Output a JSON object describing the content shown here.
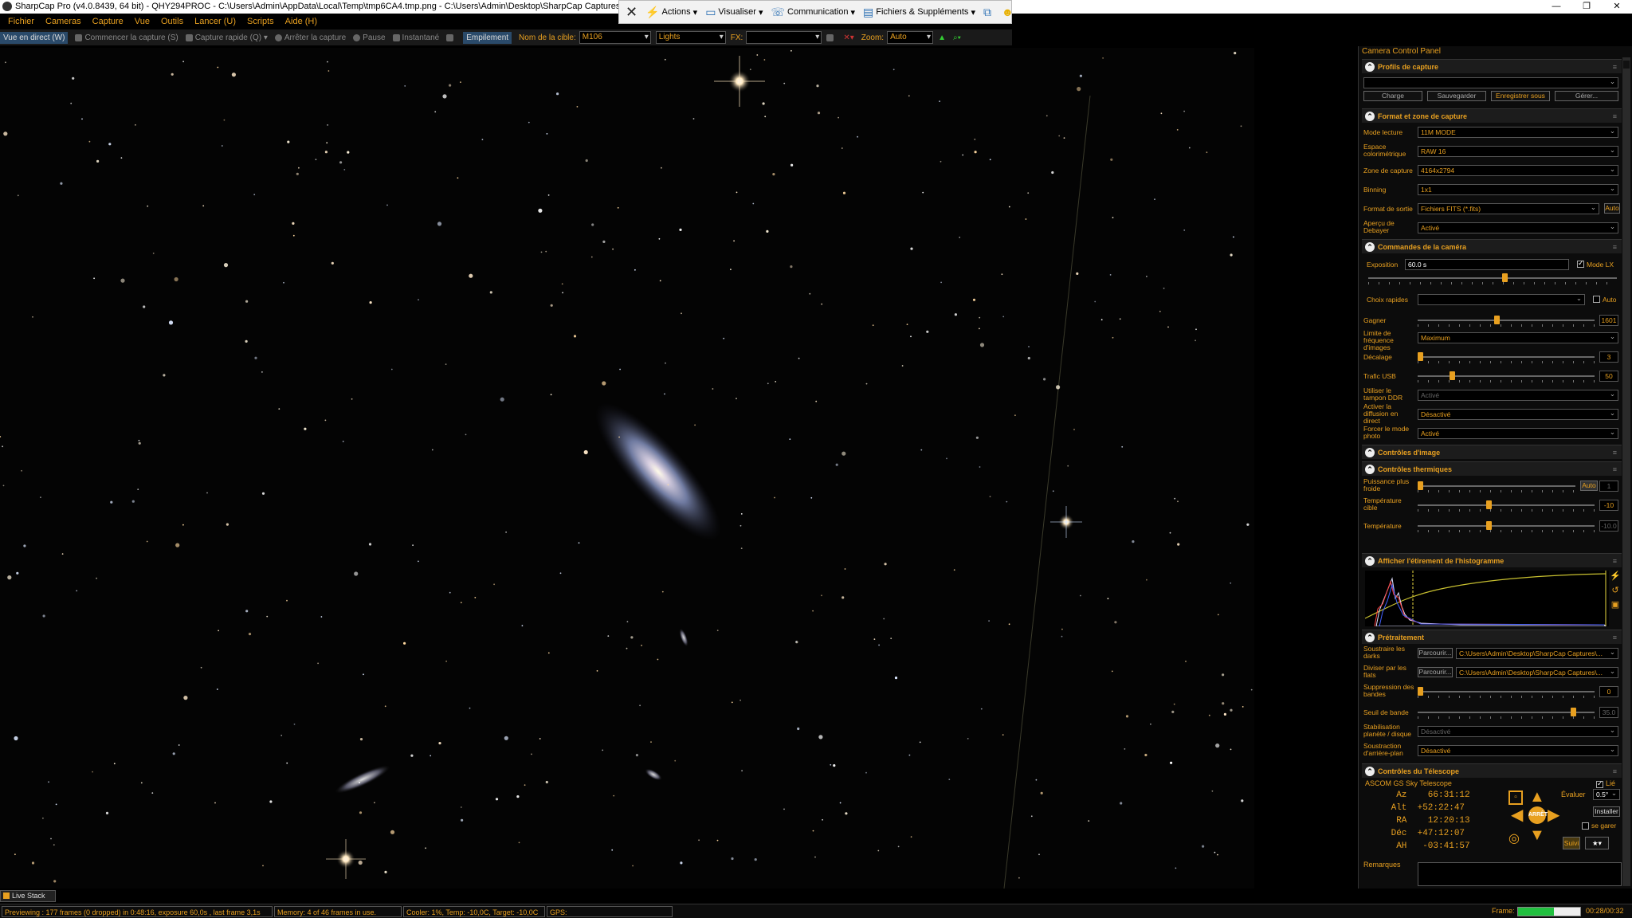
{
  "window": {
    "title": "SharpCap Pro (v4.0.8439, 64 bit) - QHY294PROC - C:\\Users\\Admin\\AppData\\Local\\Temp\\tmp6CA4.tmp.png - C:\\Users\\Admin\\Desktop\\SharpCap Captures",
    "minimize": "—",
    "maximize": "❐",
    "close": "✕"
  },
  "toolstrip": {
    "close": "✕",
    "items": [
      "Actions",
      "Visualiser",
      "Communication",
      "Fichiers & Suppléments"
    ]
  },
  "menu": [
    "Fichier",
    "Cameras",
    "Capture",
    "Vue",
    "Outils",
    "Lancer (U)",
    "Scripts",
    "Aide (H)"
  ],
  "capture_toolbar": {
    "live_view": "Vue en direct (W)",
    "start_capture": "Commencer la capture (S)",
    "quick_capture": "Capture rapide (Q)",
    "stop_capture": "Arrêter la capture",
    "pause": "Pause",
    "snapshot": "Instantané",
    "stacking": "Empilement",
    "target_label": "Nom de la cible:",
    "target_value": "M106",
    "frame_type": "Lights",
    "fx_label": "FX:",
    "fx_value": "",
    "zoom_label": "Zoom:",
    "zoom_value": "Auto"
  },
  "panel": {
    "title": "Camera Control Panel",
    "profiles": {
      "header": "Profils de capture",
      "selected": "",
      "buttons": [
        "Charge",
        "Sauvegarder",
        "Enregistrer sous",
        "Gérer..."
      ]
    },
    "format": {
      "header": "Format et zone de capture",
      "rows": [
        {
          "label": "Mode lecture",
          "value": "11M MODE"
        },
        {
          "label": "Espace colorimétrique",
          "value": "RAW 16"
        },
        {
          "label": "Zone de capture",
          "value": "4164x2794"
        },
        {
          "label": "Binning",
          "value": "1x1"
        },
        {
          "label": "Format de sortie",
          "value": "Fichiers FITS (*.fits)"
        },
        {
          "label": "Aperçu de Debayer",
          "value": "Activé"
        }
      ],
      "auto_label": "Auto"
    },
    "camera": {
      "header": "Commandes de la caméra",
      "exposure_label": "Exposition",
      "exposure_value": "60.0 s",
      "lx_mode": "Mode LX",
      "quick_pick_label": "Choix rapides",
      "quick_pick_value": "",
      "quick_pick_auto": "Auto",
      "gain_label": "Gagner",
      "gain_value": "1601",
      "framerate_label": "Limite de fréquence d'images",
      "framerate_value": "Maximum",
      "offset_label": "Décalage",
      "offset_value": "3",
      "usb_label": "Trafic USB",
      "usb_value": "50",
      "ddr_label": "Utiliser le tampon DDR",
      "ddr_value": "Activé",
      "broadcast_label": "Activer la diffusion en direct",
      "broadcast_value": "Désactivé",
      "photo_label": "Forcer le mode photo",
      "photo_value": "Activé"
    },
    "image_controls": {
      "header": "Contrôles d'image"
    },
    "thermal": {
      "header": "Contrôles thermiques",
      "cooler_label": "Puissance plus froide",
      "cooler_auto": "Auto",
      "cooler_value": "1",
      "target_label": "Température cible",
      "target_value": "-10",
      "temp_label": "Température",
      "temp_value": "-10.0"
    },
    "histogram": {
      "header": "Afficher l'étirement de l'histogramme"
    },
    "preprocessing": {
      "header": "Prétraitement",
      "dark_label": "Soustraire les darks",
      "dark_button": "Parcourir...",
      "dark_value": "C:\\Users\\Admin\\Desktop\\SharpCap Captures\\...",
      "flat_label": "Diviser par les flats",
      "flat_button": "Parcourir...",
      "flat_value": "C:\\Users\\Admin\\Desktop\\SharpCap Captures\\...",
      "banding_label": "Suppression des bandes",
      "banding_value": "0",
      "threshold_label": "Seuil de bande",
      "threshold_value": "35.0",
      "stab_label": "Stabilisation planète / disque",
      "stab_value": "Désactivé",
      "bg_label": "Soustraction d'arrière-plan",
      "bg_value": "Désactivé"
    },
    "telescope": {
      "header": "Contrôles du Télescope",
      "name": "ASCOM GS Sky Telescope",
      "linked": "Lié",
      "coords": [
        "  Az    66:31:12",
        " Alt  +52:22:47",
        "  RA    12:20:13",
        " Déc  +47:12:07",
        "  AH   -03:41:57"
      ],
      "stop": "ARRÊT",
      "rate_label": "Évaluer",
      "rate_value": "0.5°",
      "install": "Installer",
      "park": "se garer",
      "track": "Suivi"
    },
    "notes_label": "Remarques"
  },
  "live_stack_tab": "Live Stack",
  "status": {
    "preview": "Previewing : 177 frames (0 dropped) in 0:48:16, exposure 60,0s , last frame 3,1s",
    "memory": "Memory: 4 of 46 frames in use.",
    "cooler": "Cooler: 1%, Temp: -10,0C, Target: -10,0C",
    "gps": "GPS:",
    "frame_label": "Frame:",
    "frame_progress": 0.583,
    "frame_time": "00:28/00:32"
  },
  "colors": {
    "accent": "#e8a020",
    "panel_bg": "#0c0c0c",
    "sky_bg": "#040404"
  }
}
